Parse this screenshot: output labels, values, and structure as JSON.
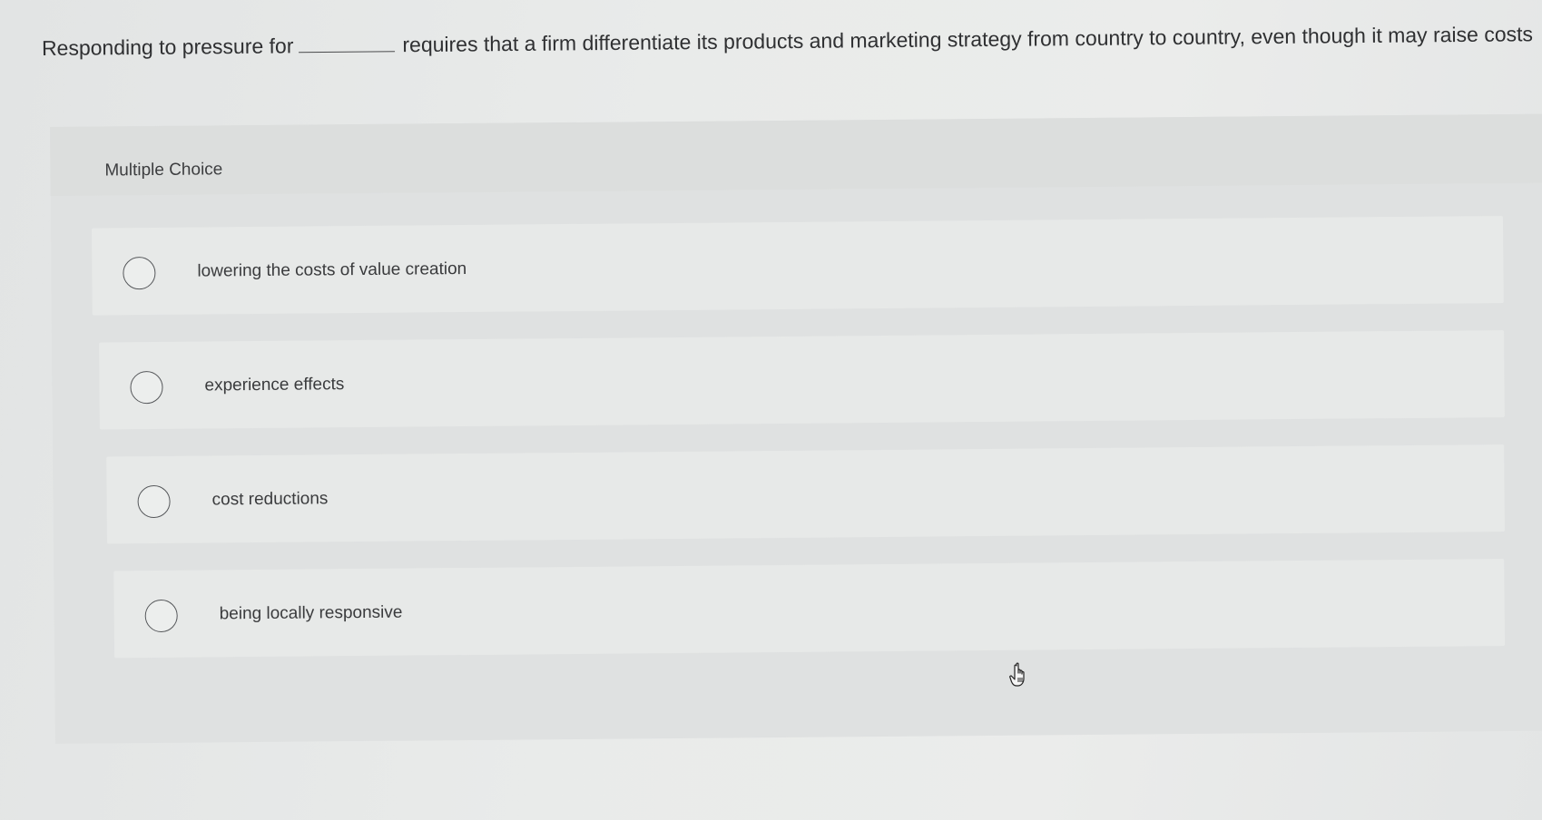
{
  "question": {
    "prefix": "Responding to pressure for",
    "suffix": "requires that a firm differentiate its products and marketing strategy from country to country, even though it may raise costs"
  },
  "multiple_choice": {
    "label": "Multiple Choice",
    "options": [
      {
        "text": "lowering the costs of value creation",
        "selected": false
      },
      {
        "text": "experience effects",
        "selected": false
      },
      {
        "text": "cost reductions",
        "selected": false
      },
      {
        "text": "being locally responsive",
        "selected": false
      }
    ]
  },
  "icons": {
    "cursor": "hand-pointer-icon"
  }
}
